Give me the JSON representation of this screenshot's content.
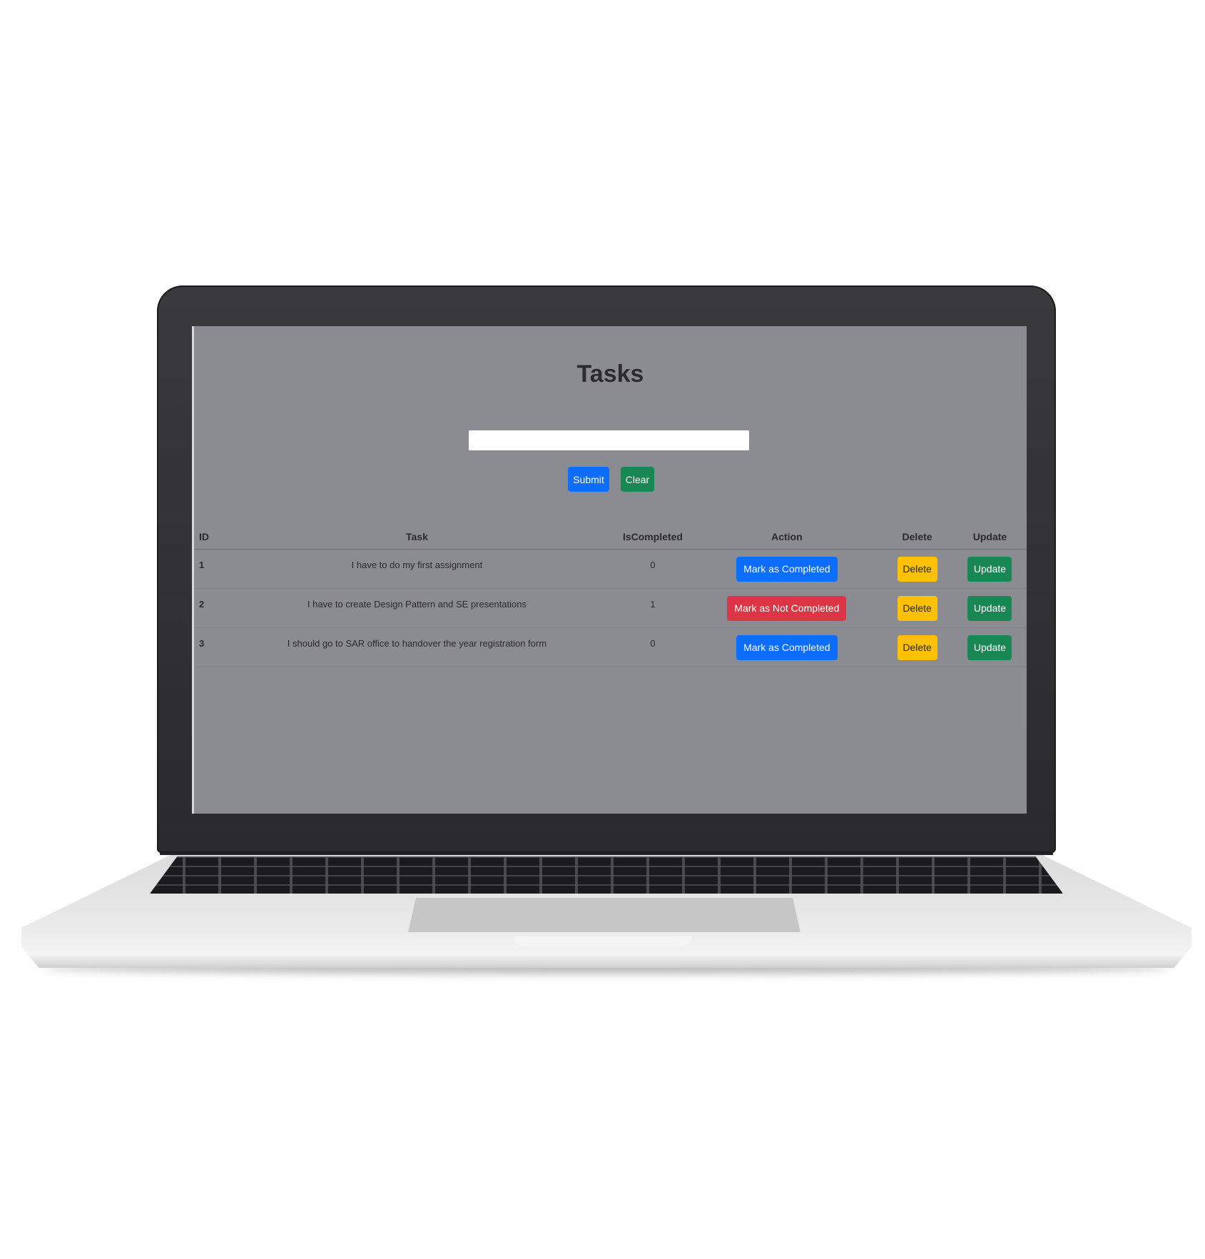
{
  "app": {
    "title": "Tasks",
    "input": {
      "value": "",
      "placeholder": ""
    },
    "submit_label": "Submit",
    "clear_label": "Clear"
  },
  "table": {
    "headers": [
      "ID",
      "Task",
      "IsCompleted",
      "Action",
      "Delete",
      "Update"
    ],
    "rows": [
      {
        "id": "1",
        "task": "I have to do my first assignment",
        "is_completed": "0",
        "action": "Mark as Completed",
        "delete": "Delete",
        "update": "Update"
      },
      {
        "id": "2",
        "task": "I have to create Design Pattern and SE presentations",
        "is_completed": "1",
        "action": "Mark as Not Completed",
        "delete": "Delete",
        "update": "Update"
      },
      {
        "id": "3",
        "task": "I should go to SAR office to handover the year registration form",
        "is_completed": "0",
        "action": "Mark as Completed",
        "delete": "Delete",
        "update": "Update"
      }
    ]
  },
  "colors": {
    "screen_bg": "#8b8c92",
    "primary": "#0d6efd",
    "success": "#198754",
    "danger": "#dc3545",
    "warning": "#ffc107"
  }
}
